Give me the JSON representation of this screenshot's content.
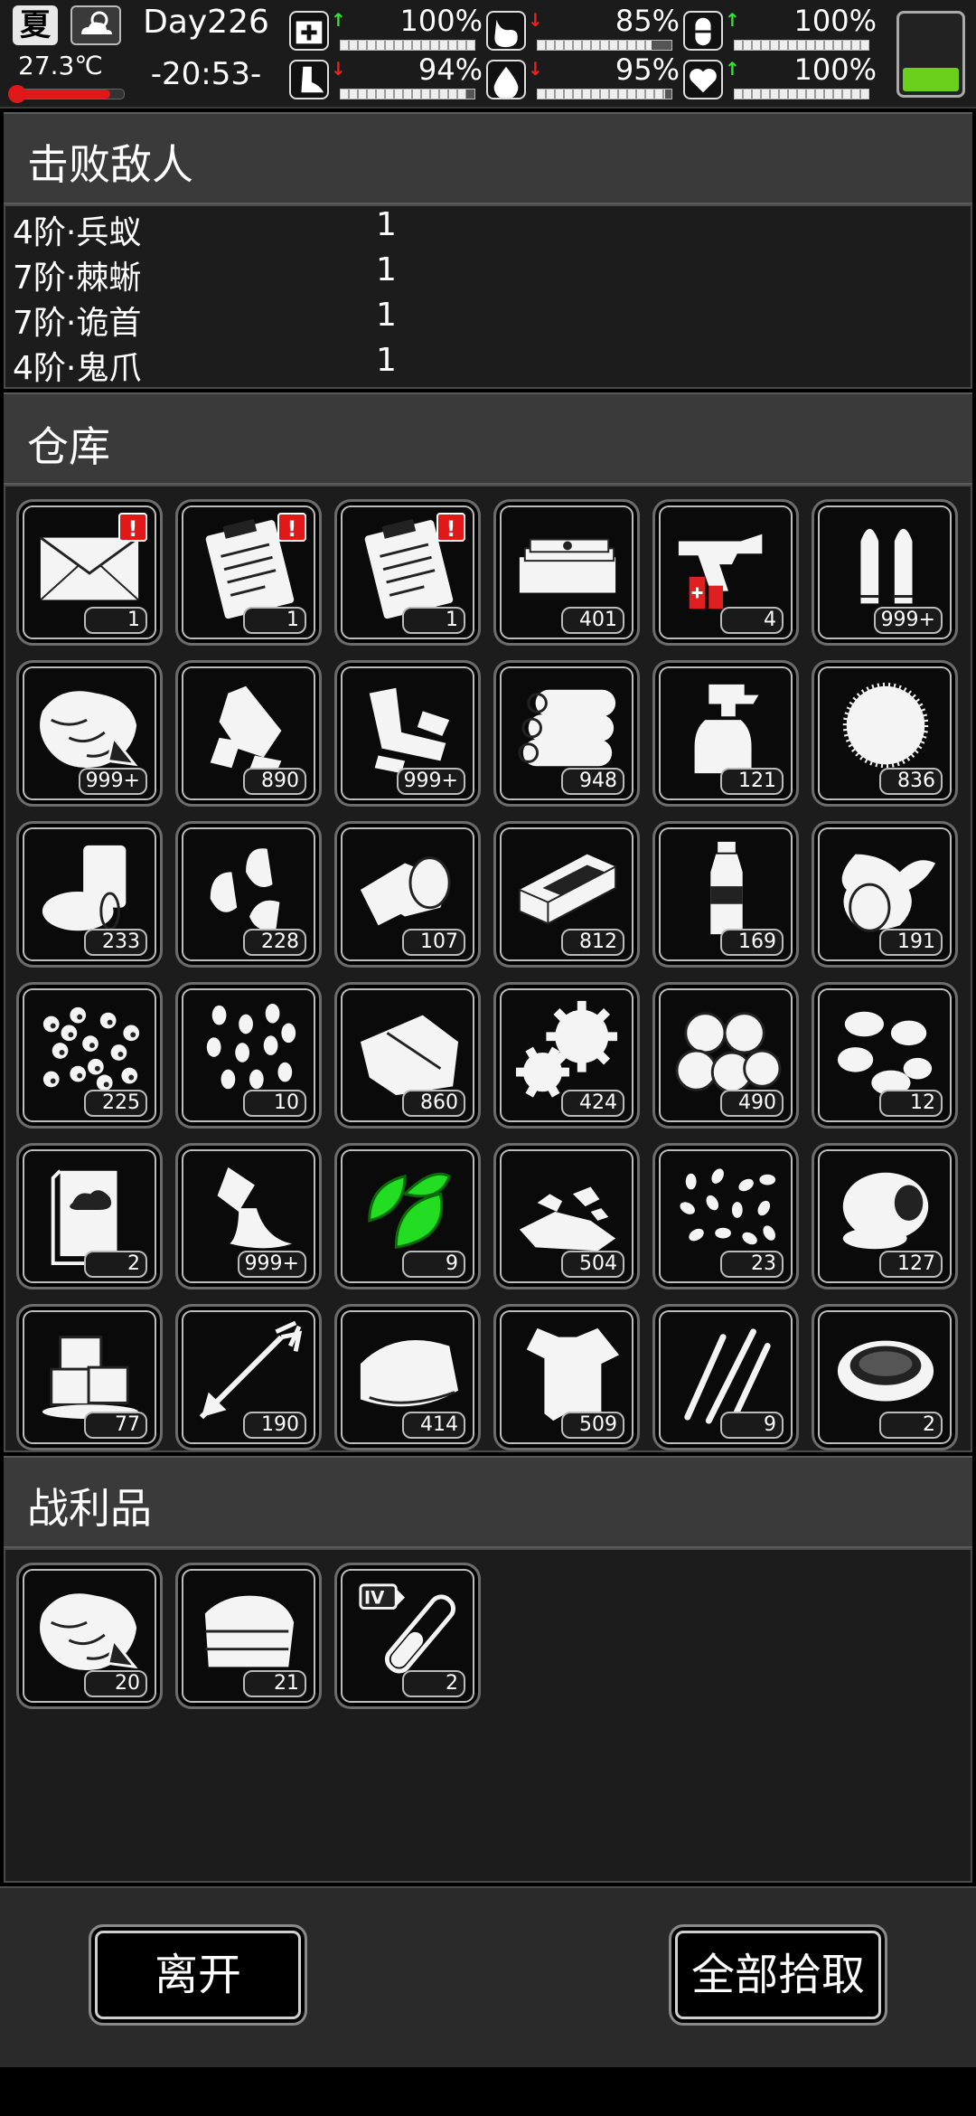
{
  "status": {
    "season": "夏",
    "weather_icon": "cloudy-day-icon",
    "temperature": "27.3℃",
    "temperature_level": 0.88,
    "day": "Day226",
    "time": "-20:53-",
    "battery_level": 0.3,
    "stats": [
      {
        "id": "health",
        "icon": "medkit-icon",
        "trend": "up",
        "value": "100%",
        "level": 1.0
      },
      {
        "id": "hunger",
        "icon": "stomach-icon",
        "trend": "down",
        "value": "85%",
        "level": 0.85
      },
      {
        "id": "stamina",
        "icon": "pill-icon",
        "trend": "up",
        "value": "100%",
        "level": 1.0
      },
      {
        "id": "mobility",
        "icon": "foot-icon",
        "trend": "down",
        "value": "94%",
        "level": 0.94
      },
      {
        "id": "thirst",
        "icon": "water-drop-icon",
        "trend": "down",
        "value": "95%",
        "level": 0.95
      },
      {
        "id": "mood",
        "icon": "heart-icon",
        "trend": "up",
        "value": "100%",
        "level": 1.0
      }
    ]
  },
  "defeated": {
    "title": "击败敌人",
    "enemies": [
      {
        "name": "4阶·兵蚁",
        "count": "1"
      },
      {
        "name": "7阶·棘蜥",
        "count": "1"
      },
      {
        "name": "7阶·诡首",
        "count": "1"
      },
      {
        "name": "4阶·鬼爪",
        "count": "1"
      }
    ]
  },
  "storage": {
    "title": "仓库",
    "items": [
      {
        "icon": "letter-icon",
        "count": "1",
        "alert": "!"
      },
      {
        "icon": "clipboard-icon",
        "count": "1",
        "alert": "!"
      },
      {
        "icon": "clipboard-icon",
        "count": "1",
        "alert": "!"
      },
      {
        "icon": "cash-stack-icon",
        "count": "401"
      },
      {
        "icon": "flare-gun-icon",
        "count": "4"
      },
      {
        "icon": "bullets-icon",
        "count": "999+"
      },
      {
        "icon": "meat-icon",
        "count": "999+"
      },
      {
        "icon": "plastic-bottle-scrap-icon",
        "count": "890"
      },
      {
        "icon": "scrap-metal-icon",
        "count": "999+"
      },
      {
        "icon": "logs-icon",
        "count": "948"
      },
      {
        "icon": "spray-bottle-icon",
        "count": "121"
      },
      {
        "icon": "cotton-icon",
        "count": "836"
      },
      {
        "icon": "cans-icon",
        "count": "233"
      },
      {
        "icon": "bullet-tips-icon",
        "count": "228"
      },
      {
        "icon": "bandage-roll-icon",
        "count": "107"
      },
      {
        "icon": "brick-icon",
        "count": "812"
      },
      {
        "icon": "water-bottle-icon",
        "count": "169"
      },
      {
        "icon": "vegetables-icon",
        "count": "191"
      },
      {
        "icon": "pellets-icon",
        "count": "225"
      },
      {
        "icon": "beans-icon",
        "count": "10"
      },
      {
        "icon": "cloth-icon",
        "count": "860"
      },
      {
        "icon": "gears-icon",
        "count": "424"
      },
      {
        "icon": "potatoes-icon",
        "count": "490"
      },
      {
        "icon": "peanuts-icon",
        "count": "12"
      },
      {
        "icon": "book-icon",
        "count": "2"
      },
      {
        "icon": "powder-icon",
        "count": "999+"
      },
      {
        "icon": "herb-leaves-icon",
        "count": "9",
        "color": "#22dd22"
      },
      {
        "icon": "rubble-icon",
        "count": "504"
      },
      {
        "icon": "seeds-icon",
        "count": "23"
      },
      {
        "icon": "egg-icon",
        "count": "127"
      },
      {
        "icon": "ice-cubes-icon",
        "count": "77"
      },
      {
        "icon": "arrow-icon",
        "count": "190"
      },
      {
        "icon": "towel-icon",
        "count": "414"
      },
      {
        "icon": "rag-shirt-icon",
        "count": "509"
      },
      {
        "icon": "claw-marks-icon",
        "count": "9"
      },
      {
        "icon": "soup-bowl-icon",
        "count": "2"
      }
    ]
  },
  "loot": {
    "title": "战利品",
    "items": [
      {
        "icon": "meat-icon",
        "count": "20"
      },
      {
        "icon": "folded-cloth-icon",
        "count": "21"
      },
      {
        "icon": "test-tube-icon",
        "count": "2",
        "tag": "IV"
      }
    ]
  },
  "buttons": {
    "leave": "离开",
    "pickup_all": "全部拾取"
  }
}
